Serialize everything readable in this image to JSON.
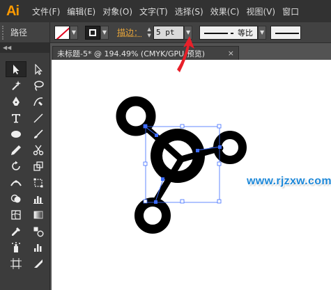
{
  "app": {
    "logo": "Ai"
  },
  "menu": [
    "文件(F)",
    "编辑(E)",
    "对象(O)",
    "文字(T)",
    "选择(S)",
    "效果(C)",
    "视图(V)",
    "窗口"
  ],
  "control": {
    "object_label": "路径",
    "stroke_label": "描边：",
    "stroke_value": "5 pt",
    "profile_label": "等比"
  },
  "document": {
    "tab_title": "未标题-5* @ 194.49% (CMYK/GPU 预览)",
    "close_glyph": "×"
  },
  "watermark": "www.rjzxw.com",
  "colors": {
    "accent": "#ff9a00",
    "stroke_label": "#e8a53a",
    "selection": "#3d6cff",
    "annotation_arrow": "#e8202a",
    "watermark": "#1e88d8"
  },
  "icons": [
    "selection-tool-icon",
    "direct-selection-tool-icon",
    "magic-wand-icon",
    "lasso-icon",
    "pen-icon",
    "curvature-icon",
    "type-icon",
    "line-icon",
    "ellipse-icon",
    "paintbrush-icon",
    "pencil-icon",
    "scissors-icon",
    "rotate-icon",
    "scale-icon",
    "width-icon",
    "free-transform-icon",
    "shape-builder-icon",
    "graph-icon",
    "mesh-icon",
    "gradient-icon",
    "eyedropper-icon",
    "blend-icon",
    "symbol-sprayer-icon",
    "column-graph-icon",
    "artboard-icon",
    "slice-icon"
  ]
}
